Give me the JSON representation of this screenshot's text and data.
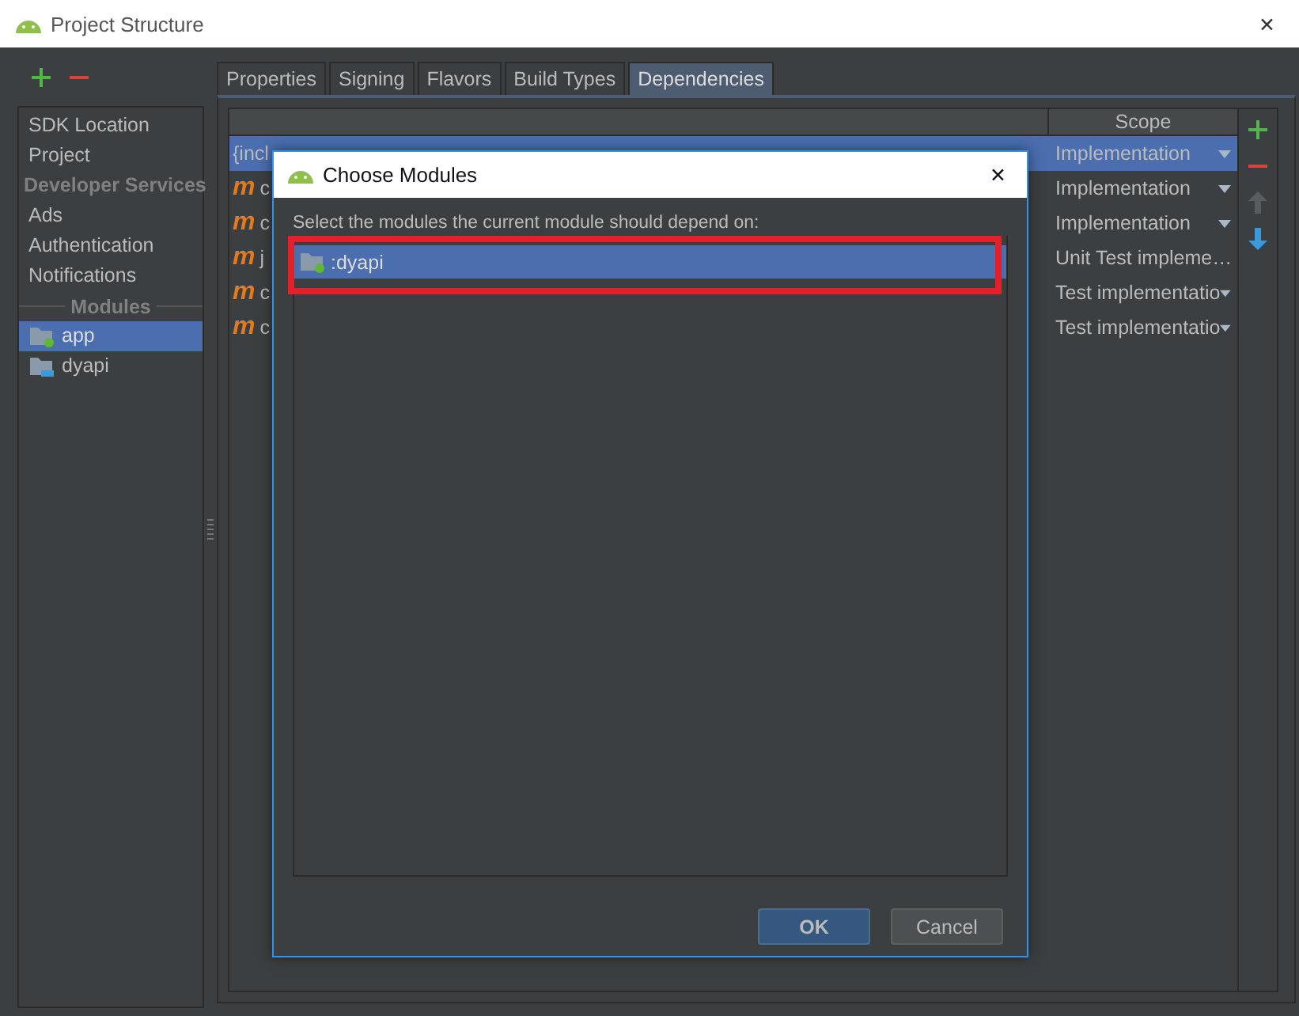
{
  "window": {
    "title": "Project Structure",
    "close": "✕"
  },
  "sidebar": {
    "items": [
      {
        "kind": "item",
        "label": "SDK Location",
        "selected": false
      },
      {
        "kind": "item",
        "label": "Project",
        "selected": false
      },
      {
        "kind": "header",
        "label": "Developer Services"
      },
      {
        "kind": "item",
        "label": "Ads",
        "selected": false
      },
      {
        "kind": "item",
        "label": "Authentication",
        "selected": false
      },
      {
        "kind": "item",
        "label": "Notifications",
        "selected": false
      },
      {
        "kind": "divider",
        "label": "Modules"
      },
      {
        "kind": "app",
        "label": "app",
        "selected": true
      },
      {
        "kind": "library",
        "label": "dyapi",
        "selected": false
      }
    ]
  },
  "tabs": [
    {
      "label": "Properties",
      "selected": false
    },
    {
      "label": "Signing",
      "selected": false
    },
    {
      "label": "Flavors",
      "selected": false
    },
    {
      "label": "Build Types",
      "selected": false
    },
    {
      "label": "Dependencies",
      "selected": true
    }
  ],
  "table": {
    "columns": [
      "Scope"
    ],
    "rows": [
      {
        "kind": "file",
        "name": "{incl",
        "scope": "Implementation",
        "selected": true
      },
      {
        "kind": "maven",
        "icon": "m",
        "name": "c",
        "scope": "Implementation",
        "selected": false
      },
      {
        "kind": "maven",
        "icon": "m",
        "name": "c",
        "scope": "Implementation",
        "selected": false
      },
      {
        "kind": "maven",
        "icon": "m",
        "name": "j",
        "scope": "Unit Test impleme…",
        "selected": false
      },
      {
        "kind": "maven",
        "icon": "m",
        "name": "c",
        "scope": "Test implementatio",
        "selected": false
      },
      {
        "kind": "maven",
        "icon": "m",
        "name": "c",
        "scope": "Test implementatio",
        "selected": false
      }
    ]
  },
  "dialog": {
    "title": "Choose Modules",
    "close": "✕",
    "prompt": "Select the modules the current module should depend on:",
    "modules": [
      {
        "kind": "app",
        "label": ":dyapi",
        "selected": true
      }
    ],
    "buttons": [
      {
        "kind": "primary",
        "label": "OK"
      },
      {
        "kind": "secondary",
        "label": "Cancel"
      }
    ]
  }
}
